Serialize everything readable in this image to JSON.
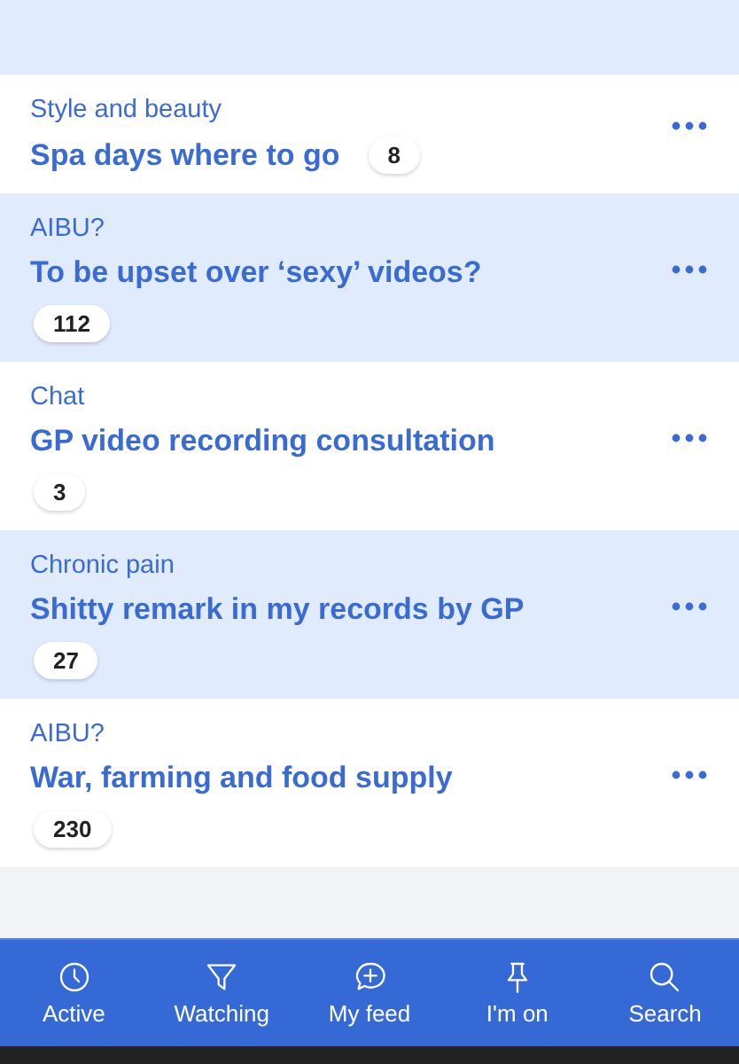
{
  "threads": [
    {
      "topic": "Style and beauty",
      "title": "Spa days where to go",
      "replies": "8",
      "highlighted": false
    },
    {
      "topic": "AIBU?",
      "title": "To be upset over ‘sexy’ videos?",
      "replies": "112",
      "highlighted": true
    },
    {
      "topic": "Chat",
      "title": "GP video recording consultation",
      "replies": "3",
      "highlighted": false
    },
    {
      "topic": "Chronic pain",
      "title": "Shitty remark in my records by GP",
      "replies": "27",
      "highlighted": true
    },
    {
      "topic": "AIBU?",
      "title": "War, farming and food supply",
      "replies": "230",
      "highlighted": false
    }
  ],
  "nav": [
    {
      "kind": "clock",
      "label": "Active"
    },
    {
      "kind": "filter",
      "label": "Watching"
    },
    {
      "kind": "feed",
      "label": "My feed"
    },
    {
      "kind": "pin",
      "label": "I'm on"
    },
    {
      "kind": "search",
      "label": "Search"
    }
  ]
}
